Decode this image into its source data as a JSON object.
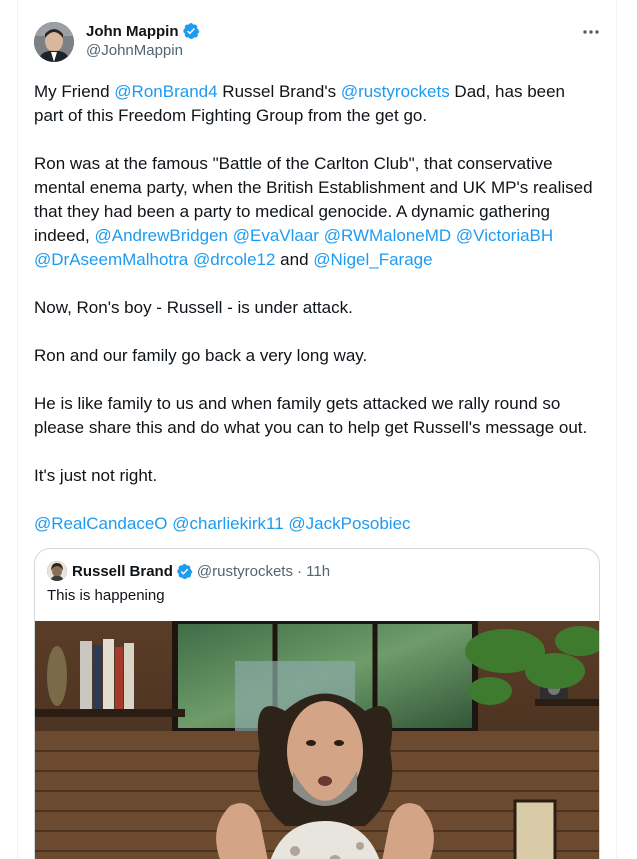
{
  "author": {
    "name": "John Mappin",
    "handle": "@JohnMappin",
    "verified": true
  },
  "more_icon": "more-horizontal-icon",
  "tweet": {
    "p1": [
      {
        "t": "My Friend "
      },
      {
        "t": "@RonBrand4",
        "link": true
      },
      {
        "t": "  Russel Brand's "
      },
      {
        "t": "@rustyrockets",
        "link": true
      },
      {
        "t": "  Dad, has been part of this Freedom Fighting Group from the get go."
      }
    ],
    "p2": [
      {
        "t": "Ron was at the famous \"Battle of the Carlton Club\", that conservative mental enema party, when the British Establishment and UK MP's realised that they had been a party to medical genocide.  A dynamic gathering indeed, "
      },
      {
        "t": "@AndrewBridgen",
        "link": true
      },
      {
        "t": " "
      },
      {
        "t": "@EvaVlaar",
        "link": true
      },
      {
        "t": " "
      },
      {
        "t": "@RWMaloneMD",
        "link": true
      },
      {
        "t": " "
      },
      {
        "t": "@VictoriaBH",
        "link": true
      },
      {
        "t": " "
      },
      {
        "t": "@DrAseemMalhotra",
        "link": true
      },
      {
        "t": " "
      },
      {
        "t": "@drcole12",
        "link": true
      },
      {
        "t": " and "
      },
      {
        "t": "@Nigel_Farage",
        "link": true
      }
    ],
    "p3": [
      {
        "t": "Now, Ron's boy - Russell - is under attack."
      }
    ],
    "p4": [
      {
        "t": "Ron and our family go back a very long way."
      }
    ],
    "p5": [
      {
        "t": "He is like family to us and when family gets attacked we rally round so please share this and do what you can to help get Russell's message out."
      }
    ],
    "p6": [
      {
        "t": "It's just not right."
      }
    ],
    "p7": [
      {
        "t": "@RealCandaceO",
        "link": true
      },
      {
        "t": " "
      },
      {
        "t": "@charliekirk11",
        "link": true
      },
      {
        "t": " "
      },
      {
        "t": "@JackPosobiec",
        "link": true
      }
    ]
  },
  "quoted": {
    "name": "Russell Brand",
    "handle": "@rustyrockets",
    "time": "· 11h",
    "text": "This is happening"
  },
  "colors": {
    "link": "#1d9bf0",
    "verified": "#1d9bf0",
    "secondary_text": "#536471"
  }
}
